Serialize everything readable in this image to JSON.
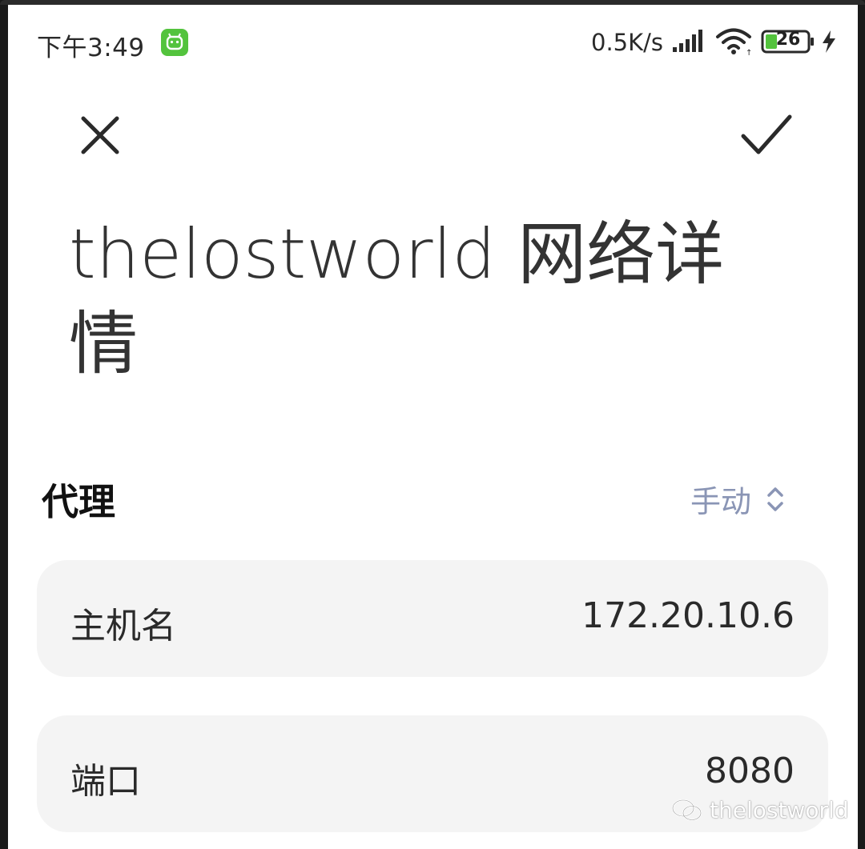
{
  "status_bar": {
    "time": "下午3:49",
    "net_speed": "0.5K/s",
    "battery_level": "26",
    "app_badge_color": "#53c33d"
  },
  "toolbar": {
    "close_icon": "close-icon",
    "confirm_icon": "check-icon"
  },
  "page": {
    "title": "thelostworld 网络详情"
  },
  "proxy": {
    "label": "代理",
    "mode_value": "手动",
    "mode_color": "#8a95b5"
  },
  "fields": {
    "hostname": {
      "label": "主机名",
      "value": "172.20.10.6"
    },
    "port": {
      "label": "端口",
      "value": "8080"
    }
  },
  "watermark": {
    "text": "thelostworld",
    "icon": "wechat-icon"
  }
}
